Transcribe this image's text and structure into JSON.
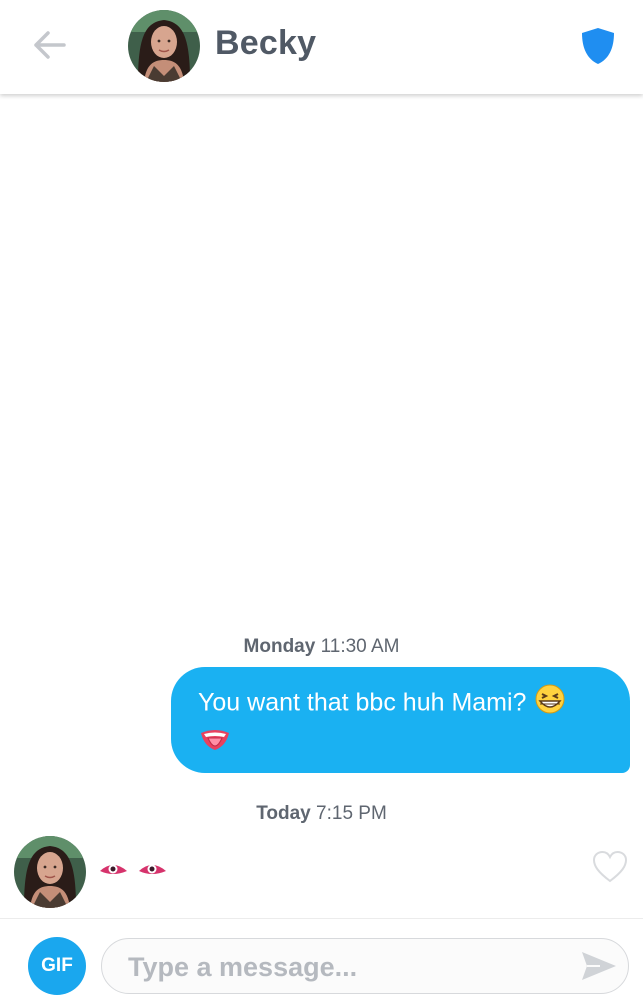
{
  "header": {
    "back_icon": "arrow-left-icon",
    "title": "Becky",
    "safety_icon": "shield-icon",
    "colors": {
      "shield": "#1f8ef1",
      "title": "#505965",
      "back": "#c4c7cc"
    }
  },
  "conversation": {
    "timestamps": [
      {
        "day": "Monday",
        "time": "11:30 AM"
      },
      {
        "day": "Today",
        "time": "7:15 PM"
      }
    ],
    "messages": [
      {
        "direction": "outgoing",
        "text": "You want that bbc huh Mami?",
        "emojis": [
          "grinning-squinting-face-icon",
          "tongue-mouth-icon"
        ],
        "bubble_color": "#1ab1f2"
      },
      {
        "direction": "incoming",
        "emojis": [
          "eye-icon",
          "eye-icon"
        ],
        "like_icon": "heart-outline-icon"
      }
    ]
  },
  "composer": {
    "gif_label": "GIF",
    "placeholder": "Type a message...",
    "value": "",
    "send_icon": "send-arrow-icon",
    "gif_color": "#1aa7ee"
  }
}
